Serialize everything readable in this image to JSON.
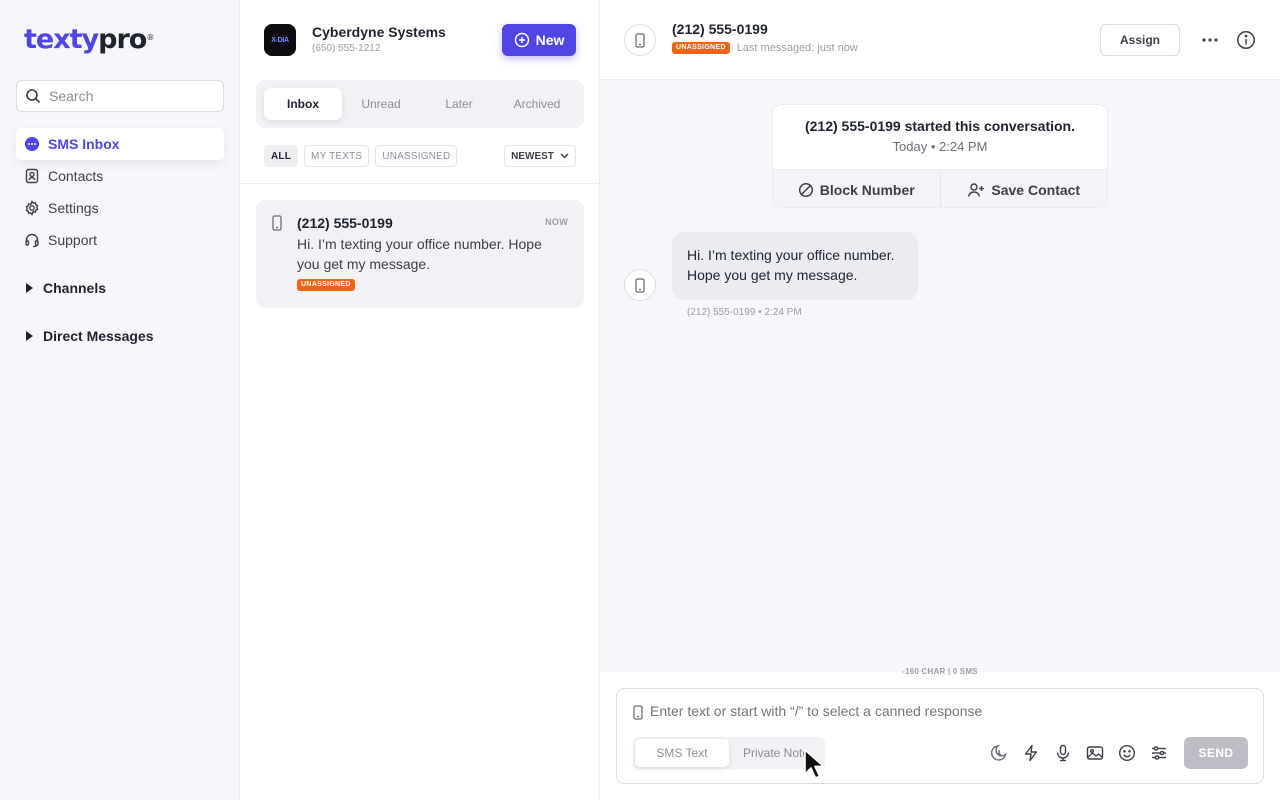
{
  "brand": {
    "logo_part1": "texty",
    "logo_part2": "pro",
    "logo_mark": "®",
    "accent": "#4f46e5",
    "badge_color": "#f36410"
  },
  "sidebar": {
    "search_placeholder": "Search",
    "items": [
      {
        "label": "SMS Inbox",
        "icon": "chat-bubble-icon",
        "active": true
      },
      {
        "label": "Contacts",
        "icon": "contact-card-icon"
      },
      {
        "label": "Settings",
        "icon": "gear-icon"
      },
      {
        "label": "Support",
        "icon": "headset-icon"
      }
    ],
    "sections": [
      {
        "label": "Channels"
      },
      {
        "label": "Direct Messages"
      }
    ]
  },
  "inbox": {
    "org_avatar_text": "X-DIA",
    "org_name": "Cyberdyne Systems",
    "org_phone": "(650) 555-1212",
    "new_label": "New",
    "tabs": [
      {
        "label": "Inbox",
        "active": true
      },
      {
        "label": "Unread"
      },
      {
        "label": "Later"
      },
      {
        "label": "Archived"
      }
    ],
    "filters": [
      {
        "label": "ALL",
        "active": true
      },
      {
        "label": "MY TEXTS"
      },
      {
        "label": "UNASSIGNED"
      }
    ],
    "sort_label": "NEWEST",
    "conversations": [
      {
        "phone": "(212) 555-0199",
        "time": "NOW",
        "preview": "Hi. I’m texting your office number. Hope you get my message.",
        "badge": "UNASSIGNED"
      }
    ]
  },
  "chat": {
    "phone": "(212) 555-0199",
    "badge": "UNASSIGNED",
    "last_messaged": "Last messaged: just now",
    "assign_label": "Assign",
    "started_text": "(212) 555-0199 started this conversation.",
    "started_time": "Today • 2:24 PM",
    "block_label": "Block Number",
    "save_label": "Save Contact",
    "messages": [
      {
        "text": "Hi. I’m texting your office number. Hope you get my message.",
        "meta": "(212) 555-0199 • 2:24 PM"
      }
    ],
    "char_count": "-160 CHAR | 0 SMS",
    "composer_placeholder": "Enter text or start with “/” to select a canned response",
    "modes": [
      {
        "label": "SMS Text",
        "active": true
      },
      {
        "label": "Private Note"
      }
    ],
    "tools": [
      "schedule-icon",
      "lightning-icon",
      "microphone-icon",
      "image-icon",
      "emoji-icon",
      "sliders-icon"
    ],
    "send_label": "SEND"
  }
}
